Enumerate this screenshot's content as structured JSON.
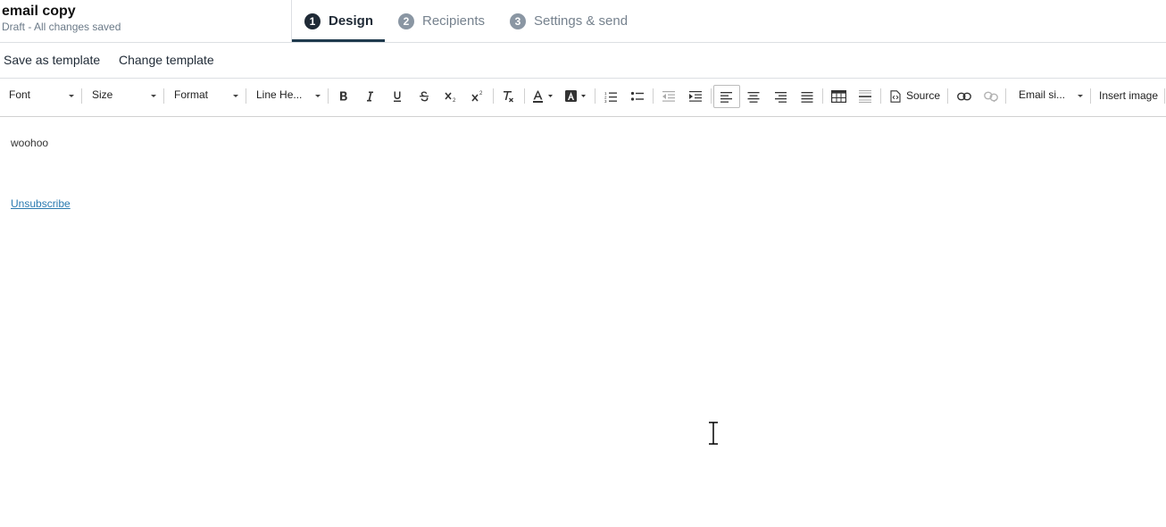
{
  "header": {
    "title": "email copy",
    "status": "Draft - All changes saved",
    "steps": [
      {
        "number": "1",
        "label": "Design",
        "active": true
      },
      {
        "number": "2",
        "label": "Recipients",
        "active": false
      },
      {
        "number": "3",
        "label": "Settings & send",
        "active": false
      }
    ]
  },
  "actions": {
    "save_as_template": "Save as template",
    "change_template": "Change template"
  },
  "toolbar": {
    "font": "Font",
    "size": "Size",
    "format": "Format",
    "line_height": "Line He...",
    "source": "Source",
    "email_signature": "Email si...",
    "insert_image": "Insert image",
    "icons": [
      "bold-icon",
      "italic-icon",
      "underline-icon",
      "strikethrough-icon",
      "subscript-icon",
      "superscript-icon",
      "remove-format-icon",
      "text-color-icon",
      "background-color-icon",
      "numbered-list-icon",
      "bulleted-list-icon",
      "decrease-indent-icon",
      "increase-indent-icon",
      "align-left-icon",
      "align-center-icon",
      "align-right-icon",
      "justify-icon",
      "table-icon",
      "horizontal-line-icon",
      "source-icon",
      "link-icon",
      "unlink-icon"
    ],
    "active_alignment": "left"
  },
  "content": {
    "body": "woohoo",
    "unsubscribe": "Unsubscribe"
  },
  "colors": {
    "accent": "#1f3a4d",
    "link": "#2a7ab0",
    "muted": "#76828e"
  }
}
